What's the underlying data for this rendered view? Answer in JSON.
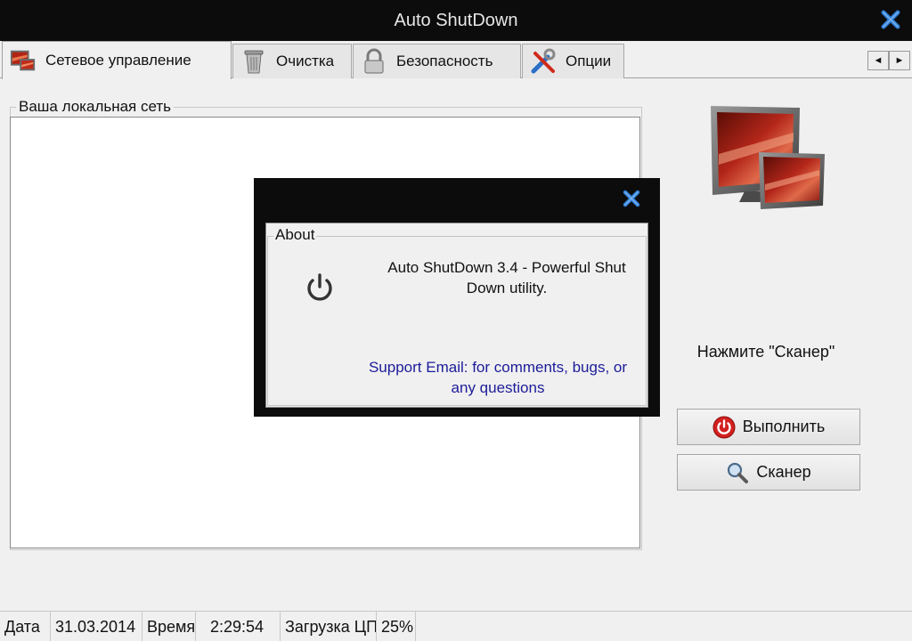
{
  "window": {
    "title": "Auto ShutDown"
  },
  "tabs": [
    {
      "label": "Сетевое управление",
      "icon": "network-monitor-icon"
    },
    {
      "label": "Очистка",
      "icon": "trash-icon"
    },
    {
      "label": "Безопасность",
      "icon": "lock-icon"
    },
    {
      "label": "Опции",
      "icon": "tools-icon"
    }
  ],
  "tab_scroll": {
    "left": "◄",
    "right": "►"
  },
  "network": {
    "group_title": "Ваша локальная сеть"
  },
  "sidebar": {
    "hint": "Нажмите \"Сканер\"",
    "run_label": "Выполнить",
    "scan_label": "Сканер"
  },
  "about": {
    "group_title": "About",
    "description": "Auto ShutDown 3.4 - Powerful Shut Down utility.",
    "email": "Support Email: for comments, bugs, or any questions"
  },
  "status": {
    "date_label": "Дата",
    "date_value": "31.03.2014",
    "time_label": "Время",
    "time_value": "2:29:54",
    "cpu_label": "Загрузка ЦП",
    "cpu_value": "25%"
  },
  "colors": {
    "titlebar": "#0c0c0c",
    "accent_close": "#2f7fd8",
    "link": "#1c1c9a",
    "power_red": "#d42020"
  }
}
